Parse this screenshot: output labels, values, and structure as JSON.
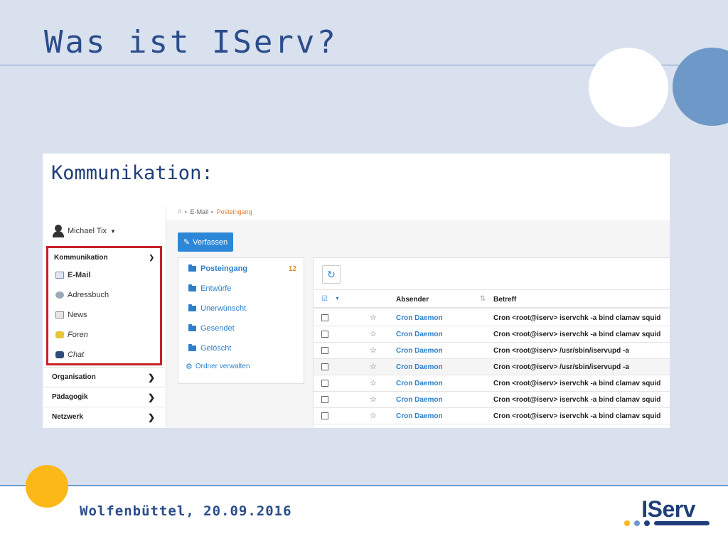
{
  "slide": {
    "title": "Was ist IServ?",
    "footer": "Wolfenbüttel, 20.09.2016",
    "logo_text": "IServ",
    "colors": {
      "blue_dark": "#1f3f7a",
      "blue_light": "#6d98c7",
      "yellow": "#fbb817",
      "red_highlight": "#c8202a"
    }
  },
  "screenshot": {
    "heading": "Kommunikation:",
    "user": {
      "name": "Michael Tix",
      "icon": "user-icon"
    },
    "sidebar": {
      "komm_label": "Kommunikation",
      "komm_items": [
        {
          "label": "E-Mail",
          "icon": "envelope-icon"
        },
        {
          "label": "Adressbuch",
          "icon": "address-book-icon"
        },
        {
          "label": "News",
          "icon": "news-icon"
        },
        {
          "label": "Foren",
          "icon": "forum-icon"
        },
        {
          "label": "Chat",
          "icon": "chat-icon"
        }
      ],
      "groups": [
        {
          "label": "Organisation"
        },
        {
          "label": "Pädagogik"
        },
        {
          "label": "Netzwerk"
        }
      ]
    },
    "breadcrumb": {
      "level1": "E-Mail",
      "level2": "Posteingang"
    },
    "compose_label": "Verfassen",
    "folders": [
      {
        "label": "Posteingang",
        "count": "12"
      },
      {
        "label": "Entwürfe"
      },
      {
        "label": "Unerwünscht"
      },
      {
        "label": "Gesendet"
      },
      {
        "label": "Gelöscht"
      }
    ],
    "manage_folders": "Ordner verwalten",
    "columns": {
      "sender": "Absender",
      "subject": "Betreff"
    },
    "mails": [
      {
        "sender": "Cron Daemon",
        "subject": "Cron <root@iserv> iservchk -a bind clamav squid"
      },
      {
        "sender": "Cron Daemon",
        "subject": "Cron <root@iserv> iservchk -a bind clamav squid"
      },
      {
        "sender": "Cron Daemon",
        "subject": "Cron <root@iserv> /usr/sbin/iservupd -a"
      },
      {
        "sender": "Cron Daemon",
        "subject": "Cron <root@iserv> /usr/sbin/iservupd -a"
      },
      {
        "sender": "Cron Daemon",
        "subject": "Cron <root@iserv> iservchk -a bind clamav squid"
      },
      {
        "sender": "Cron Daemon",
        "subject": "Cron <root@iserv> iservchk -a bind clamav squid"
      },
      {
        "sender": "Cron Daemon",
        "subject": "Cron <root@iserv> iservchk -a bind clamav squid"
      }
    ]
  }
}
